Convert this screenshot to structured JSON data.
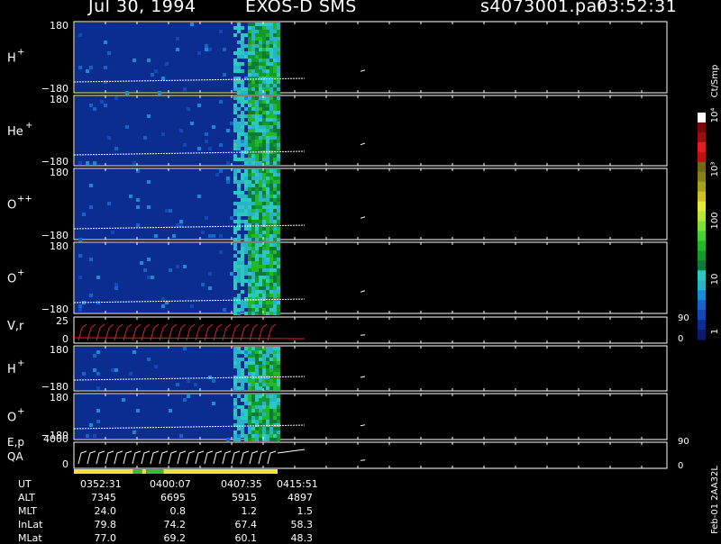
{
  "header": {
    "date": "Jul 30, 1994",
    "instrument": "EXOS-D SMS",
    "file": "s4073001.par",
    "time": "03:52:31"
  },
  "footer_note": "Feb-01 2AA32L",
  "colorbar": {
    "unit_label": "Ct/Smp",
    "tick_labels": [
      "1",
      "10",
      "100",
      "10³",
      "10⁴"
    ],
    "colors": [
      "#0b1a6b",
      "#0b2d8f",
      "#1447b8",
      "#1366c8",
      "#1a8cd6",
      "#27b3c8",
      "#2cc9c0",
      "#0e7a38",
      "#129a2c",
      "#22b82a",
      "#47d233",
      "#7fe03a",
      "#b8e83c",
      "#e8e83a",
      "#d0c028",
      "#a8a020",
      "#8a8018",
      "#726a14",
      "#c01010",
      "#e02020",
      "#981010",
      "#7a0808",
      "#ffffff"
    ]
  },
  "chart_data": [
    {
      "type": "heatmap",
      "panel": "H+",
      "label_base": "H",
      "label_sup": "+",
      "ylim": [
        -180,
        180
      ],
      "ytick_labels": [
        "180",
        "−180"
      ]
    },
    {
      "type": "heatmap",
      "panel": "He+",
      "label_base": "He",
      "label_sup": "+",
      "ylim": [
        -180,
        180
      ],
      "ytick_labels": [
        "180",
        "−180"
      ]
    },
    {
      "type": "heatmap",
      "panel": "O++",
      "label_base": "O",
      "label_sup": "++",
      "ylim": [
        -180,
        180
      ],
      "ytick_labels": [
        "180",
        "−180"
      ]
    },
    {
      "type": "heatmap",
      "panel": "O+",
      "label_base": "O",
      "label_sup": "+",
      "ylim": [
        -180,
        180
      ],
      "ytick_labels": [
        "180",
        "−180"
      ]
    },
    {
      "type": "line",
      "panel": "V,r",
      "label_base": "V,r",
      "label_sup": "",
      "ylim": [
        0,
        25
      ],
      "ytick_labels": [
        "25",
        "0"
      ],
      "right_tick_labels": [
        "90",
        "0"
      ]
    },
    {
      "type": "heatmap",
      "panel": "H+ (2)",
      "label_base": "H",
      "label_sup": "+",
      "ylim": [
        -180,
        180
      ],
      "ytick_labels": [
        "180",
        "−180"
      ]
    },
    {
      "type": "heatmap",
      "panel": "O+ (2)",
      "label_base": "O",
      "label_sup": "+",
      "ylim": [
        -180,
        180
      ],
      "ytick_labels": [
        "180",
        "−180"
      ]
    },
    {
      "type": "line",
      "panel": "E,p QA",
      "label_base": "E,p",
      "label_line2": "QA",
      "ylim": [
        0,
        4000
      ],
      "ytick_labels": [
        "4000",
        "0"
      ],
      "right_tick_labels": [
        "90",
        "0"
      ]
    }
  ],
  "qa_bar": [
    {
      "color": "#f0e040",
      "from": 0.0,
      "to": 0.29
    },
    {
      "color": "#30c030",
      "from": 0.29,
      "to": 0.335
    },
    {
      "color": "#f0e040",
      "from": 0.335,
      "to": 0.355
    },
    {
      "color": "#30c030",
      "from": 0.355,
      "to": 0.44
    },
    {
      "color": "#f0e040",
      "from": 0.44,
      "to": 1.0
    }
  ],
  "ephemeris": {
    "rows": [
      {
        "name": "UT",
        "values": [
          "0352:31",
          "0400:07",
          "0407:35",
          "0415:51"
        ]
      },
      {
        "name": "ALT",
        "values": [
          "7345",
          "6695",
          "5915",
          "4897"
        ]
      },
      {
        "name": "MLT",
        "values": [
          "24.0",
          "0.8",
          "1.2",
          "1.5"
        ]
      },
      {
        "name": "InLat",
        "values": [
          "79.8",
          "74.2",
          "67.4",
          "58.3"
        ]
      },
      {
        "name": "MLat",
        "values": [
          "77.0",
          "69.2",
          "60.1",
          "48.3"
        ]
      }
    ]
  }
}
